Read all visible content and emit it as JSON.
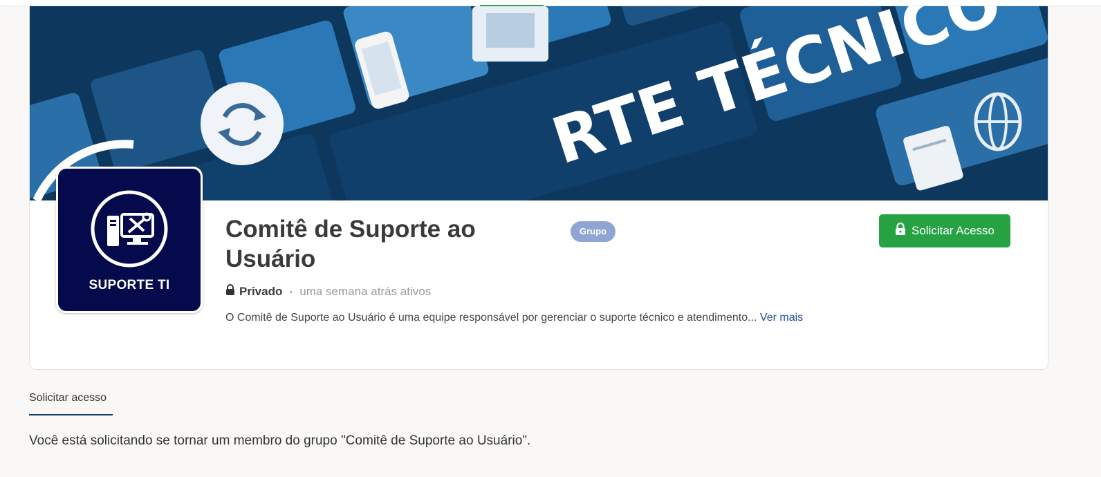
{
  "cover": {
    "image_text": "RTE TÉCNICO",
    "colors": {
      "dark": "#0e3a62",
      "key": "#1d5f96",
      "accent": "#2a82c3"
    }
  },
  "group": {
    "avatar_text": "SUPORTE TI",
    "title": "Comitê de Suporte ao Usuário",
    "badge": "Grupo",
    "privacy": "Privado",
    "activity": "uma semana atrás ativos",
    "description": "O Comitê de Suporte ao Usuário é uma equipe responsável por gerenciar o suporte técnico e atendimento...",
    "see_more": "Ver mais"
  },
  "actions": {
    "request_access": "Solicitar Acesso"
  },
  "tabs": [
    {
      "label": "Solicitar acesso",
      "active": true
    }
  ],
  "request_message": "Você está solicitando se tornar um membro do grupo \"Comitê de Suporte ao Usuário\".",
  "colors": {
    "primary_green": "#27a243",
    "badge_blue": "#8fa6d4",
    "link_blue": "#1f4b8f",
    "avatar_bg": "#040a4b"
  },
  "icons": [
    "lock-icon",
    "computer-tools-icon",
    "sync-icon",
    "phone-icon",
    "globe-icon"
  ]
}
